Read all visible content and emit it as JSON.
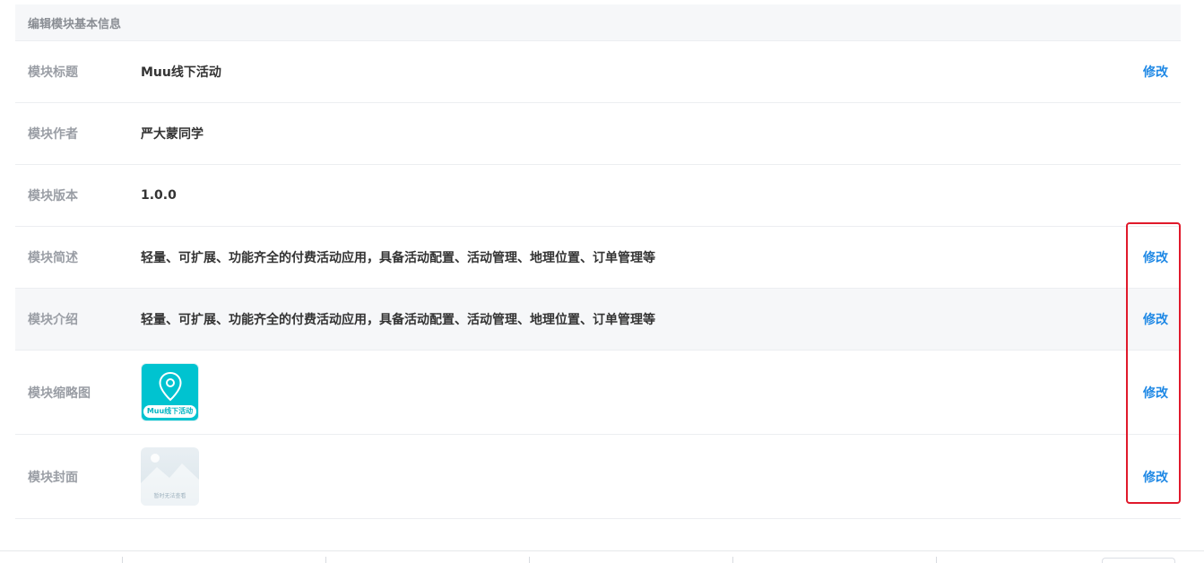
{
  "panel": {
    "header_title": "编辑模块基本信息",
    "action_label": "修改",
    "rows": [
      {
        "label": "模块标题",
        "value": "Muu线下活动"
      },
      {
        "label": "模块作者",
        "value": "严大蒙同学"
      },
      {
        "label": "模块版本",
        "value": "1.0.0"
      },
      {
        "label": "模块简述",
        "value": "轻量、可扩展、功能齐全的付费活动应用，具备活动配置、活动管理、地理位置、订单管理等"
      },
      {
        "label": "模块介绍",
        "value": "轻量、可扩展、功能齐全的付费活动应用，具备活动配置、活动管理、地理位置、订单管理等"
      },
      {
        "label": "模块缩略图",
        "image_caption": "Muu线下活动",
        "image_icon": "location-pin-icon"
      },
      {
        "label": "模块封面",
        "image_caption": "暂时无法查看",
        "image_icon": "image-placeholder-icon"
      }
    ]
  },
  "colors": {
    "accent": "#1e88e5",
    "highlight_box": "#e0192b",
    "thumb_bg": "#00c3d0"
  }
}
